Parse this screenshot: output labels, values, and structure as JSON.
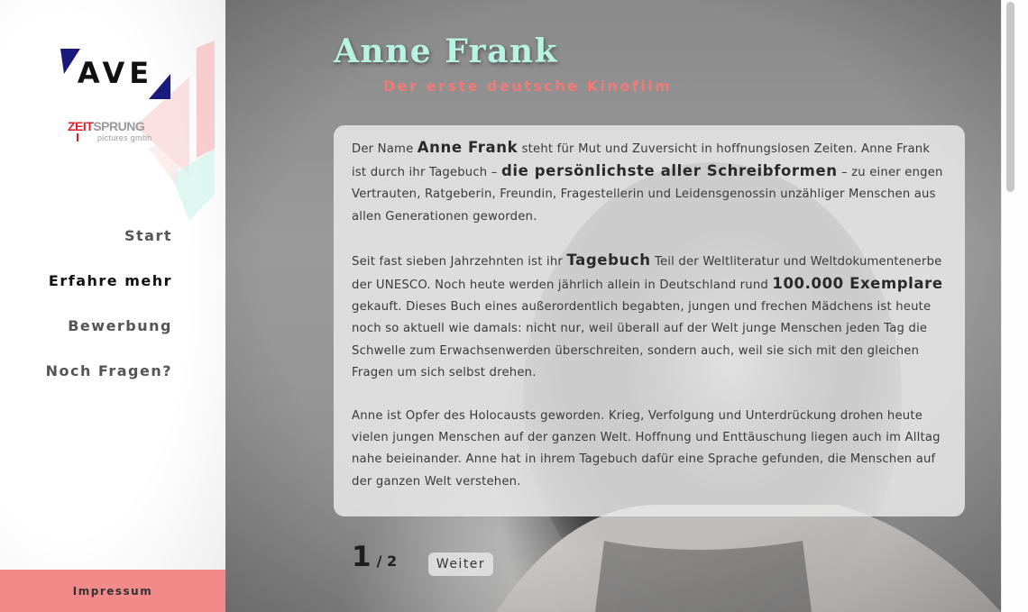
{
  "sidebar": {
    "logo_text": "AVE",
    "company_logo": {
      "part1": "ZEIT",
      "part2": "SPRUNG",
      "sub": "pictures gmbh"
    },
    "nav": [
      {
        "label": "Start",
        "active": false
      },
      {
        "label": "Erfahre mehr",
        "active": true
      },
      {
        "label": "Bewerbung",
        "active": false
      },
      {
        "label": "Noch Fragen?",
        "active": false
      }
    ],
    "footer_link": "Impressum"
  },
  "main": {
    "title": "Anne Frank",
    "subtitle": "Der erste deutsche Kinofilm",
    "content": {
      "p1": {
        "t1": "Der Name ",
        "b1": "Anne Frank",
        "t2": " steht für Mut und Zuversicht in hoffnungslosen Zeiten. Anne Frank ist durch ihr Tagebuch – ",
        "b2": "die persönlichste aller Schreibformen",
        "t3": " – zu einer engen Vertrauten, Ratgeberin, Freundin, Fragestellerin und Leidensgenossin unzähliger Menschen aus allen Generationen geworden."
      },
      "p2": {
        "t1": "Seit fast sieben Jahrzehnten ist ihr ",
        "b1": "Tagebuch",
        "t2": " Teil der Weltliteratur und Weltdokumentenerbe der UNESCO. Noch heute werden jährlich allein in Deutschland rund ",
        "b2": "100.000 Exemplare",
        "t3": " gekauft. Dieses Buch eines außerordentlich begabten, jungen und frechen Mädchens ist heute noch so aktuell wie damals: nicht nur, weil überall auf der Welt junge Menschen jeden Tag die Schwelle zum Erwachsenwerden überschreiten, sondern auch, weil sie sich mit den gleichen Fragen um sich selbst drehen."
      },
      "p3": "Anne ist Opfer des Holocausts geworden. Krieg, Verfolgung und Unterdrückung drohen heute vielen jungen Menschen auf der ganzen Welt. Hoffnung und Enttäuschung liegen auch im Alltag nahe beieinander. Anne hat in ihrem Tagebuch dafür eine Sprache gefunden, die Menschen auf der ganzen Welt verstehen."
    },
    "pagination": {
      "current": "1",
      "total": "/ 2",
      "next_label": "Weiter"
    }
  },
  "colors": {
    "title": "#b8f2e0",
    "subtitle": "#f07a78",
    "footer": "#f28a8a"
  },
  "background_image": "black-and-white portrait photo"
}
